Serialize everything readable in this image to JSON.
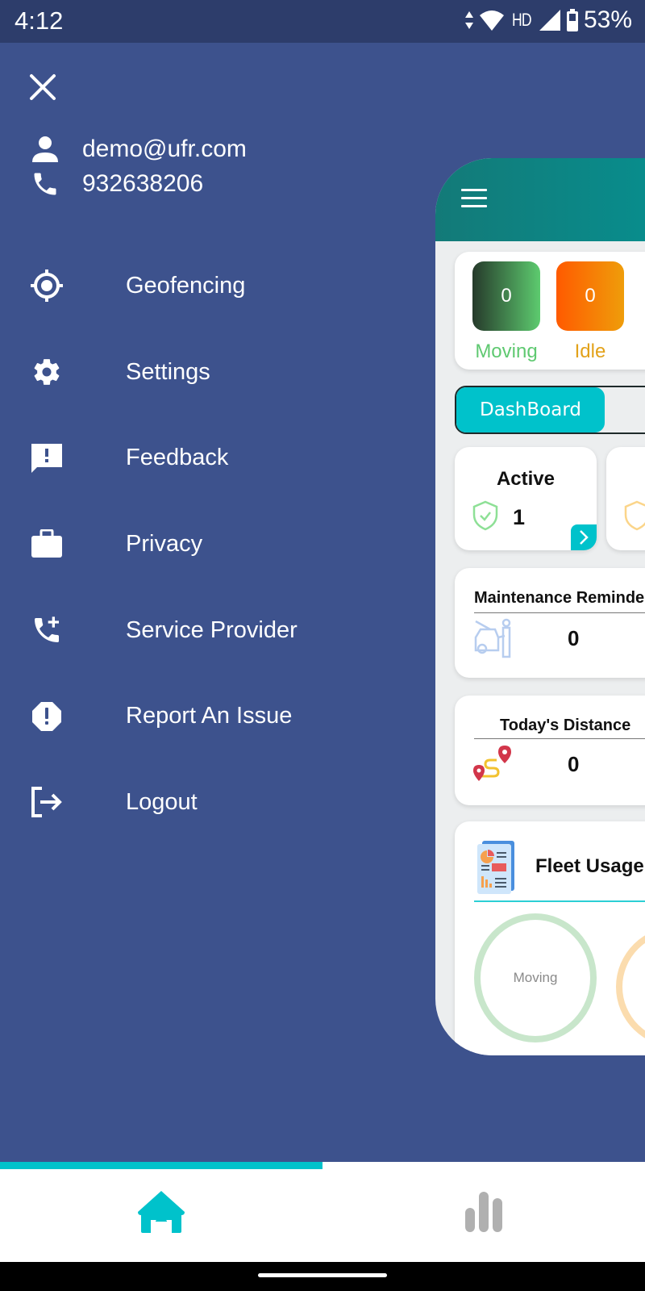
{
  "status_bar": {
    "time": "4:12",
    "network_label": "HD",
    "battery_percent": "53%"
  },
  "drawer": {
    "close_icon": "close-icon",
    "user": {
      "email": "demo@ufr.com",
      "phone": "932638206"
    },
    "menu": [
      {
        "label": "Geofencing",
        "icon": "gps-target-icon"
      },
      {
        "label": "Settings",
        "icon": "gear-icon"
      },
      {
        "label": "Feedback",
        "icon": "feedback-icon"
      },
      {
        "label": "Privacy",
        "icon": "briefcase-icon"
      },
      {
        "label": "Service Provider",
        "icon": "phone-add-icon"
      },
      {
        "label": "Report An Issue",
        "icon": "report-icon"
      },
      {
        "label": "Logout",
        "icon": "logout-icon"
      }
    ]
  },
  "preview": {
    "status_tiles": [
      {
        "label": "Moving",
        "value": "0",
        "color": "#5fc971"
      },
      {
        "label": "Idle",
        "value": "0",
        "color": "#e3a21a"
      }
    ],
    "tab_active": "DashBoard",
    "active_card": {
      "title": "Active",
      "value": "1"
    },
    "maintenance": {
      "title": "Maintenance Reminder",
      "value": "0"
    },
    "distance": {
      "title": "Today's Distance",
      "value": "0"
    },
    "fleet_usage": {
      "title": "Fleet Usage",
      "ring_label": "Moving"
    }
  },
  "bottom_nav": {
    "items": [
      {
        "name": "home",
        "icon": "home-icon",
        "active": true
      },
      {
        "name": "reports",
        "icon": "bar-chart-icon",
        "active": false
      }
    ]
  },
  "colors": {
    "drawer_bg": "#3d528d",
    "accent": "#00c2cb",
    "header_teal": "#078f8f"
  }
}
